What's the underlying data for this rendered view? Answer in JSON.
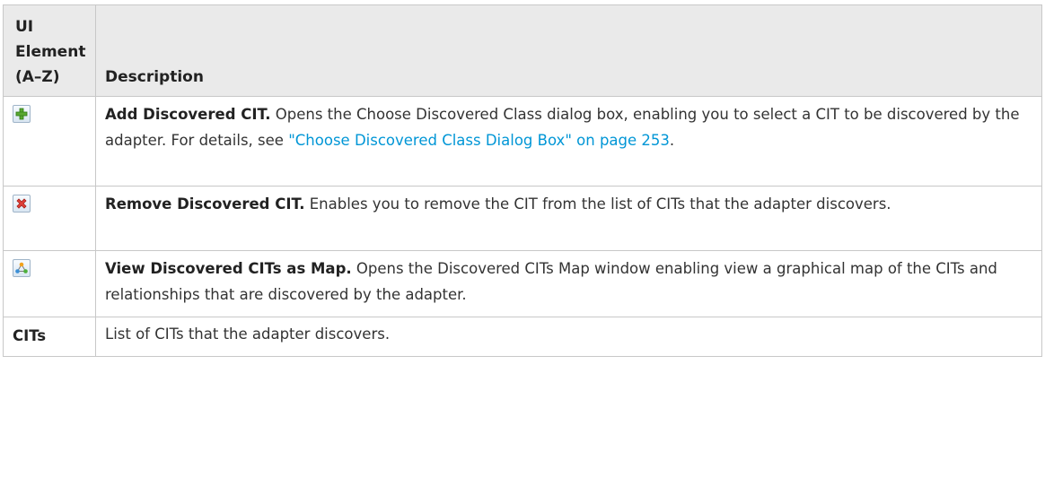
{
  "table": {
    "headers": {
      "element": "UI Element (A–Z)",
      "description": "Description"
    },
    "rows": [
      {
        "icon": "add-green-plus-icon",
        "term": "Add Discovered CIT.",
        "description": " Opens the Choose Discovered Class dialog box, enabling you to select a CIT to be discovered by the adapter. For details, see ",
        "link": "\"Choose Discovered Class Dialog Box\" on page 253",
        "tail": "."
      },
      {
        "icon": "remove-red-x-icon",
        "term": "Remove Discovered CIT.",
        "description": " Enables you to remove the CIT from the list of CITs that the adapter discovers."
      },
      {
        "icon": "view-map-icon",
        "term": "View Discovered CITs as Map.",
        "description": " Opens the Discovered CITs Map window enabling view a graphical map of the CITs and relationships that are discovered by the adapter."
      },
      {
        "element": "CITs",
        "description": "List of CITs that the adapter discovers."
      }
    ]
  },
  "colors": {
    "header_bg": "#eaeaea",
    "border": "#c8c8c8",
    "link": "#0096d6",
    "text": "#333333"
  }
}
